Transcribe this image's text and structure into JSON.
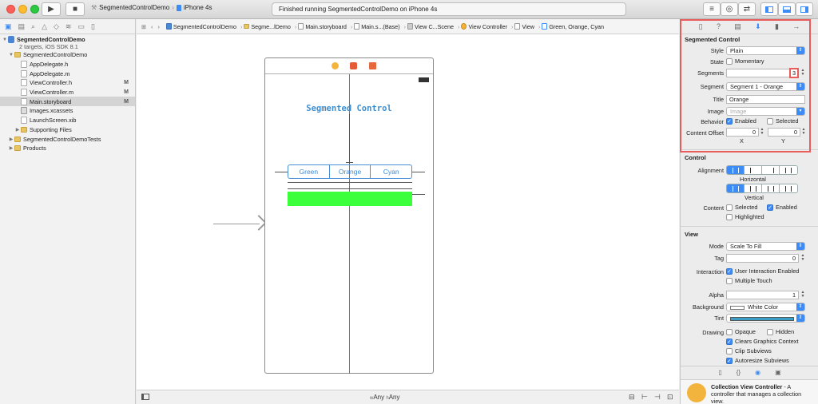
{
  "toolbar": {
    "scheme_target": "SegmentedControlDemo",
    "scheme_device": "iPhone 4s",
    "activity": "Finished running SegmentedControlDemo on iPhone 4s"
  },
  "navigator": {
    "items": [
      {
        "label": "SegmentedControlDemo",
        "sub": "2 targets, iOS SDK 8.1",
        "kind": "project"
      },
      {
        "label": "SegmentedControlDemo",
        "kind": "folder"
      },
      {
        "label": "AppDelegate.h",
        "kind": "h",
        "badge": ""
      },
      {
        "label": "AppDelegate.m",
        "kind": "m",
        "badge": ""
      },
      {
        "label": "ViewController.h",
        "kind": "h",
        "badge": "M"
      },
      {
        "label": "ViewController.m",
        "kind": "m",
        "badge": "M"
      },
      {
        "label": "Main.storyboard",
        "kind": "storyboard",
        "badge": "M"
      },
      {
        "label": "Images.xcassets",
        "kind": "assets",
        "badge": ""
      },
      {
        "label": "LaunchScreen.xib",
        "kind": "xib",
        "badge": ""
      },
      {
        "label": "Supporting Files",
        "kind": "folder"
      },
      {
        "label": "SegmentedControlDemoTests",
        "kind": "folder"
      },
      {
        "label": "Products",
        "kind": "folder"
      }
    ]
  },
  "jumpbar": {
    "crumbs": [
      "SegmentedControlDemo",
      "Segme...lDemo",
      "Main.storyboard",
      "Main.s...(Base)",
      "View C...Scene",
      "View Controller",
      "View",
      "Green, Orange, Cyan"
    ]
  },
  "canvas": {
    "title_label": "Segmented Control",
    "segments": [
      "Green",
      "Orange",
      "Cyan"
    ],
    "green_color": "#3cff3c",
    "size_class_w": "w",
    "size_class_w_value": "Any",
    "size_class_h": "h",
    "size_class_h_value": "Any"
  },
  "inspector": {
    "segmented_control": {
      "header": "Segmented Control",
      "style_label": "Style",
      "style_value": "Plain",
      "state_label": "State",
      "state_momentary": "Momentary",
      "segments_label": "Segments",
      "segments_value": "3",
      "segment_label": "Segment",
      "segment_value": "Segment 1 - Orange",
      "title_label": "Title",
      "title_value": "Orange",
      "image_label": "Image",
      "image_placeholder": "Image",
      "behavior_label": "Behavior",
      "behavior_enabled": "Enabled",
      "behavior_selected": "Selected",
      "offset_label": "Content Offset",
      "offset_x": "0",
      "offset_y": "0",
      "x_caption": "X",
      "y_caption": "Y"
    },
    "control": {
      "header": "Control",
      "alignment_label": "Alignment",
      "horizontal": "Horizontal",
      "vertical": "Vertical",
      "content_label": "Content",
      "content_selected": "Selected",
      "content_enabled": "Enabled",
      "content_highlighted": "Highlighted"
    },
    "view": {
      "header": "View",
      "mode_label": "Mode",
      "mode_value": "Scale To Fill",
      "tag_label": "Tag",
      "tag_value": "0",
      "interaction_label": "Interaction",
      "user_interaction": "User Interaction Enabled",
      "multiple_touch": "Multiple Touch",
      "alpha_label": "Alpha",
      "alpha_value": "1",
      "background_label": "Background",
      "background_value": "White Color",
      "tint_label": "Tint",
      "tint_color": "#3a9fc7",
      "drawing_label": "Drawing",
      "opaque": "Opaque",
      "hidden": "Hidden",
      "clears": "Clears Graphics Context",
      "clip": "Clip Subviews",
      "autoresize": "Autoresize Subviews"
    },
    "library": {
      "title": "Collection View Controller",
      "desc": " - A controller that manages a collection view."
    }
  }
}
